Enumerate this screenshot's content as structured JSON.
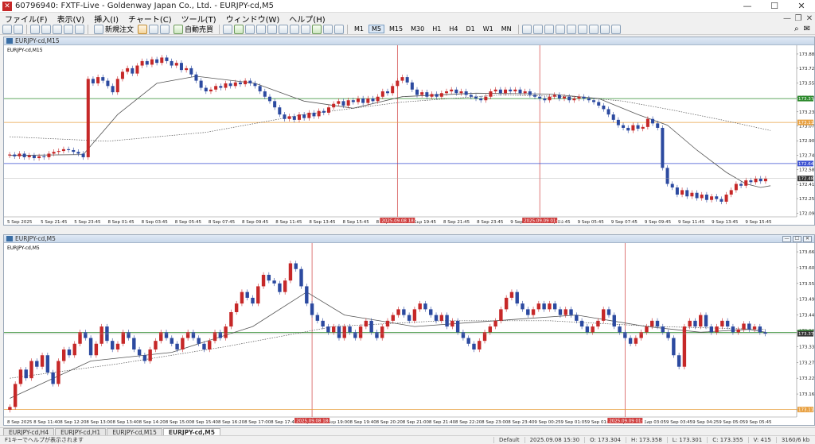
{
  "window": {
    "title": "60796940: FXTF-Live - Goldenway Japan Co., Ltd. - EURJPY-cd,M5",
    "app_icon": "mt4-logo-icon",
    "controls": [
      "—",
      "☐",
      "✕"
    ]
  },
  "menu": {
    "items": [
      "ファイル(F)",
      "表示(V)",
      "挿入(I)",
      "チャート(C)",
      "ツール(T)",
      "ウィンドウ(W)",
      "ヘルプ(H)"
    ],
    "right": [
      "—",
      "❐",
      "✕"
    ]
  },
  "toolbar": {
    "new_order": "新規注文",
    "auto_trade": "自動売買",
    "timeframes": [
      "M1",
      "M5",
      "M15",
      "M30",
      "H1",
      "H4",
      "D1",
      "W1",
      "MN"
    ],
    "active_timeframe": "M5"
  },
  "colors": {
    "bull": "#c62828",
    "bear": "#2c4aa0",
    "ma_solid": "#555555",
    "ma_dotted": "#555555",
    "green_line": "#2e8b2e",
    "orange_line": "#e8a040",
    "blue_line": "#3a4fd0",
    "vline": "#d04040",
    "current": "#333333"
  },
  "charts": [
    {
      "caption": "EURJPY-cd,M15",
      "symbol_label": "EURJPY-cd,M15",
      "y_ticks": [
        "173.880",
        "173.720",
        "173.555",
        "173.395",
        "173.230",
        "173.070",
        "172.905",
        "172.740",
        "172.580",
        "172.415",
        "172.255",
        "172.090"
      ],
      "y_top": 173.96,
      "y_bottom": 172.05,
      "x_labels": [
        "5 Sep 2025",
        "5 Sep 21:45",
        "5 Sep 23:45",
        "8 Sep 01:45",
        "8 Sep 03:45",
        "8 Sep 05:45",
        "8 Sep 07:45",
        "8 Sep 09:45",
        "8 Sep 11:45",
        "8 Sep 13:45",
        "8 Sep 15:45",
        "8 Sep 17:45",
        "8 Sep 19:45",
        "8 Sep 21:45",
        "8 Sep 23:45",
        "9 Sep 01:45",
        "9 Sep 03:45",
        "9 Sep 05:45",
        "9 Sep 07:45",
        "9 Sep 09:45",
        "9 Sep 11:45",
        "9 Sep 13:45",
        "9 Sep 15:45"
      ],
      "vlines": [
        {
          "label": "2025.09.08 18:30",
          "index": 79
        },
        {
          "label": "2025.09.09 01:45",
          "index": 108
        }
      ],
      "hlines": [
        {
          "price": 173.379,
          "label": "173.379",
          "type": "green"
        },
        {
          "price": 173.111,
          "label": "173.111",
          "type": "orange"
        },
        {
          "price": 172.649,
          "label": "172.649",
          "type": "blue"
        }
      ],
      "current_price": {
        "price": 172.481,
        "label": "172.481"
      },
      "closes": [
        172.75,
        172.73,
        172.76,
        172.72,
        172.74,
        172.71,
        172.73,
        172.72,
        172.76,
        172.78,
        172.79,
        172.81,
        172.8,
        172.78,
        172.76,
        172.72,
        173.6,
        173.55,
        173.62,
        173.58,
        173.52,
        173.45,
        173.6,
        173.68,
        173.72,
        173.66,
        173.75,
        173.8,
        173.76,
        173.82,
        173.78,
        173.84,
        173.8,
        173.75,
        173.78,
        173.7,
        173.72,
        173.65,
        173.58,
        173.5,
        173.46,
        173.48,
        173.52,
        173.5,
        173.55,
        173.52,
        173.56,
        173.54,
        173.58,
        173.55,
        173.52,
        173.46,
        173.4,
        173.35,
        173.28,
        173.2,
        173.15,
        173.18,
        173.14,
        173.2,
        173.16,
        173.22,
        173.18,
        173.24,
        173.22,
        173.28,
        173.32,
        173.35,
        173.3,
        173.36,
        173.34,
        173.38,
        173.33,
        173.38,
        173.35,
        173.4,
        173.46,
        173.44,
        173.52,
        173.58,
        173.62,
        173.56,
        173.48,
        173.42,
        173.45,
        173.4,
        173.43,
        173.4,
        173.44,
        173.46,
        173.48,
        173.44,
        173.46,
        173.42,
        173.4,
        173.38,
        173.36,
        173.4,
        173.46,
        173.48,
        173.44,
        173.48,
        173.46,
        173.48,
        173.44,
        173.46,
        173.42,
        173.4,
        173.38,
        173.36,
        173.4,
        173.42,
        173.38,
        173.4,
        173.36,
        173.38,
        173.4,
        173.38,
        173.36,
        173.34,
        173.3,
        173.26,
        173.2,
        173.14,
        173.08,
        173.05,
        173.02,
        173.08,
        173.04,
        173.06,
        173.15,
        173.1,
        173.05,
        172.6,
        172.42,
        172.38,
        172.3,
        172.35,
        172.28,
        172.32,
        172.26,
        172.3,
        172.24,
        172.28,
        172.25,
        172.22,
        172.3,
        172.35,
        172.42,
        172.4,
        172.46,
        172.44,
        172.48,
        172.45,
        172.48
      ],
      "ma_fast": [
        [
          0,
          172.74
        ],
        [
          15,
          172.75
        ],
        [
          22,
          173.2
        ],
        [
          30,
          173.55
        ],
        [
          38,
          173.63
        ],
        [
          50,
          173.55
        ],
        [
          60,
          173.35
        ],
        [
          70,
          173.27
        ],
        [
          80,
          173.4
        ],
        [
          95,
          173.44
        ],
        [
          110,
          173.43
        ],
        [
          120,
          173.38
        ],
        [
          128,
          173.2
        ],
        [
          134,
          173.08
        ],
        [
          140,
          172.8
        ],
        [
          146,
          172.55
        ],
        [
          150,
          172.42
        ],
        [
          153,
          172.38
        ],
        [
          155,
          172.4
        ]
      ],
      "ma_slow": [
        [
          0,
          172.95
        ],
        [
          20,
          172.9
        ],
        [
          40,
          173.0
        ],
        [
          60,
          173.2
        ],
        [
          80,
          173.34
        ],
        [
          100,
          173.42
        ],
        [
          115,
          173.4
        ],
        [
          125,
          173.35
        ],
        [
          135,
          173.25
        ],
        [
          145,
          173.14
        ],
        [
          155,
          173.02
        ]
      ]
    },
    {
      "caption": "EURJPY-cd,M5",
      "symbol_label": "EURJPY-cd,M5",
      "y_ticks": [
        "173.660",
        "173.605",
        "173.550",
        "173.495",
        "173.440",
        "173.385",
        "173.330",
        "173.275",
        "173.220",
        "173.165",
        "173.110"
      ],
      "y_top": 173.685,
      "y_bottom": 173.085,
      "x_labels": [
        "8 Sep 2025",
        "8 Sep 11:40",
        "8 Sep 12:20",
        "8 Sep 13:00",
        "8 Sep 13:40",
        "8 Sep 14:20",
        "8 Sep 15:00",
        "8 Sep 15:40",
        "8 Sep 16:20",
        "8 Sep 17:00",
        "8 Sep 17:40",
        "8 Sep 18:20",
        "8 Sep 19:00",
        "8 Sep 19:40",
        "8 Sep 20:20",
        "8 Sep 21:00",
        "8 Sep 21:40",
        "8 Sep 22:20",
        "8 Sep 23:00",
        "8 Sep 23:40",
        "9 Sep 00:25",
        "9 Sep 01:05",
        "9 Sep 01:45",
        "9 Sep 02:25",
        "9 Sep 03:05",
        "9 Sep 03:45",
        "9 Sep 04:25",
        "9 Sep 05:05",
        "9 Sep 05:45"
      ],
      "vlines": [
        {
          "label": "2025.09.08 18:30",
          "index": 56
        },
        {
          "label": "2025.09.09 01:45",
          "index": 114
        }
      ],
      "hlines": [
        {
          "price": 173.379,
          "label": "173.379",
          "type": "green"
        },
        {
          "price": 173.111,
          "label": "173.111",
          "type": "orange"
        }
      ],
      "current_price": {
        "price": 173.375,
        "label": "173.375"
      },
      "closes": [
        173.12,
        173.2,
        173.25,
        173.22,
        173.28,
        173.26,
        173.3,
        173.24,
        173.2,
        173.28,
        173.32,
        173.3,
        173.34,
        173.38,
        173.36,
        173.3,
        173.34,
        173.4,
        173.35,
        173.32,
        173.34,
        173.38,
        173.36,
        173.32,
        173.3,
        173.28,
        173.32,
        173.35,
        173.38,
        173.36,
        173.34,
        173.32,
        173.36,
        173.38,
        173.36,
        173.34,
        173.32,
        173.35,
        173.38,
        173.36,
        173.4,
        173.45,
        173.48,
        173.52,
        173.5,
        173.48,
        173.54,
        173.58,
        173.56,
        173.55,
        173.52,
        173.56,
        173.62,
        173.6,
        173.54,
        173.48,
        173.44,
        173.42,
        173.4,
        173.38,
        173.4,
        173.36,
        173.4,
        173.38,
        173.36,
        173.4,
        173.42,
        173.38,
        173.36,
        173.4,
        173.42,
        173.44,
        173.46,
        173.44,
        173.42,
        173.46,
        173.48,
        173.46,
        173.44,
        173.42,
        173.44,
        173.4,
        173.42,
        173.38,
        173.36,
        173.34,
        173.32,
        173.35,
        173.38,
        173.4,
        173.42,
        173.46,
        173.5,
        173.52,
        173.48,
        173.46,
        173.44,
        173.46,
        173.48,
        173.46,
        173.48,
        173.46,
        173.44,
        173.46,
        173.44,
        173.42,
        173.4,
        173.38,
        173.4,
        173.42,
        173.46,
        173.44,
        173.4,
        173.38,
        173.36,
        173.34,
        173.36,
        173.38,
        173.4,
        173.42,
        173.4,
        173.38,
        173.36,
        173.3,
        173.26,
        173.4,
        173.42,
        173.4,
        173.44,
        173.4,
        173.38,
        173.4,
        173.42,
        173.4,
        173.38,
        173.39,
        173.41,
        173.39,
        173.4,
        173.38,
        173.375
      ],
      "ma_fast": [
        [
          0,
          173.15
        ],
        [
          15,
          173.28
        ],
        [
          30,
          173.31
        ],
        [
          45,
          173.4
        ],
        [
          55,
          173.52
        ],
        [
          62,
          173.44
        ],
        [
          75,
          173.4
        ],
        [
          90,
          173.42
        ],
        [
          105,
          173.44
        ],
        [
          118,
          173.4
        ],
        [
          128,
          173.38
        ],
        [
          137,
          173.39
        ],
        [
          140,
          173.38
        ]
      ],
      "ma_slow": [
        [
          0,
          173.22
        ],
        [
          20,
          173.27
        ],
        [
          40,
          173.33
        ],
        [
          60,
          173.4
        ],
        [
          80,
          173.42
        ],
        [
          100,
          173.42
        ],
        [
          120,
          173.4
        ],
        [
          140,
          173.39
        ]
      ]
    }
  ],
  "tabs": [
    "EURJPY-cd,H4",
    "EURJPY-cd,H1",
    "EURJPY-cd,M15",
    "EURJPY-cd,M5"
  ],
  "active_tab": "EURJPY-cd,M5",
  "status": {
    "help": "F1キーでヘルプが表示されます",
    "profile": "Default",
    "datetime": "2025.09.08 15:30",
    "open": "O: 173.304",
    "high": "H: 173.358",
    "low": "L: 173.301",
    "close": "C: 173.355",
    "volume": "V: 415",
    "traffic": "3160/6 kb"
  }
}
